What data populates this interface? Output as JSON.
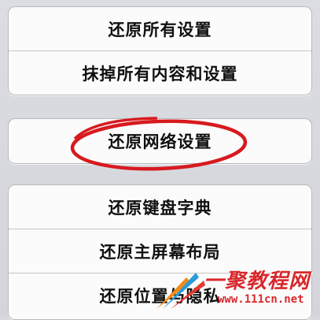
{
  "settings_reset": {
    "group_1": {
      "items": [
        {
          "label": "还原所有设置"
        },
        {
          "label": "抹掉所有内容和设置"
        }
      ]
    },
    "group_2": {
      "items": [
        {
          "label": "还原网络设置"
        }
      ]
    },
    "group_3": {
      "items": [
        {
          "label": "还原键盘字典"
        },
        {
          "label": "还原主屏幕布局"
        },
        {
          "label": "还原位置与隐私"
        }
      ]
    }
  },
  "annotation": {
    "highlight_color": "#d71a1f"
  },
  "watermark": {
    "title": "一聚教程网",
    "url": "www.111cn.net"
  }
}
